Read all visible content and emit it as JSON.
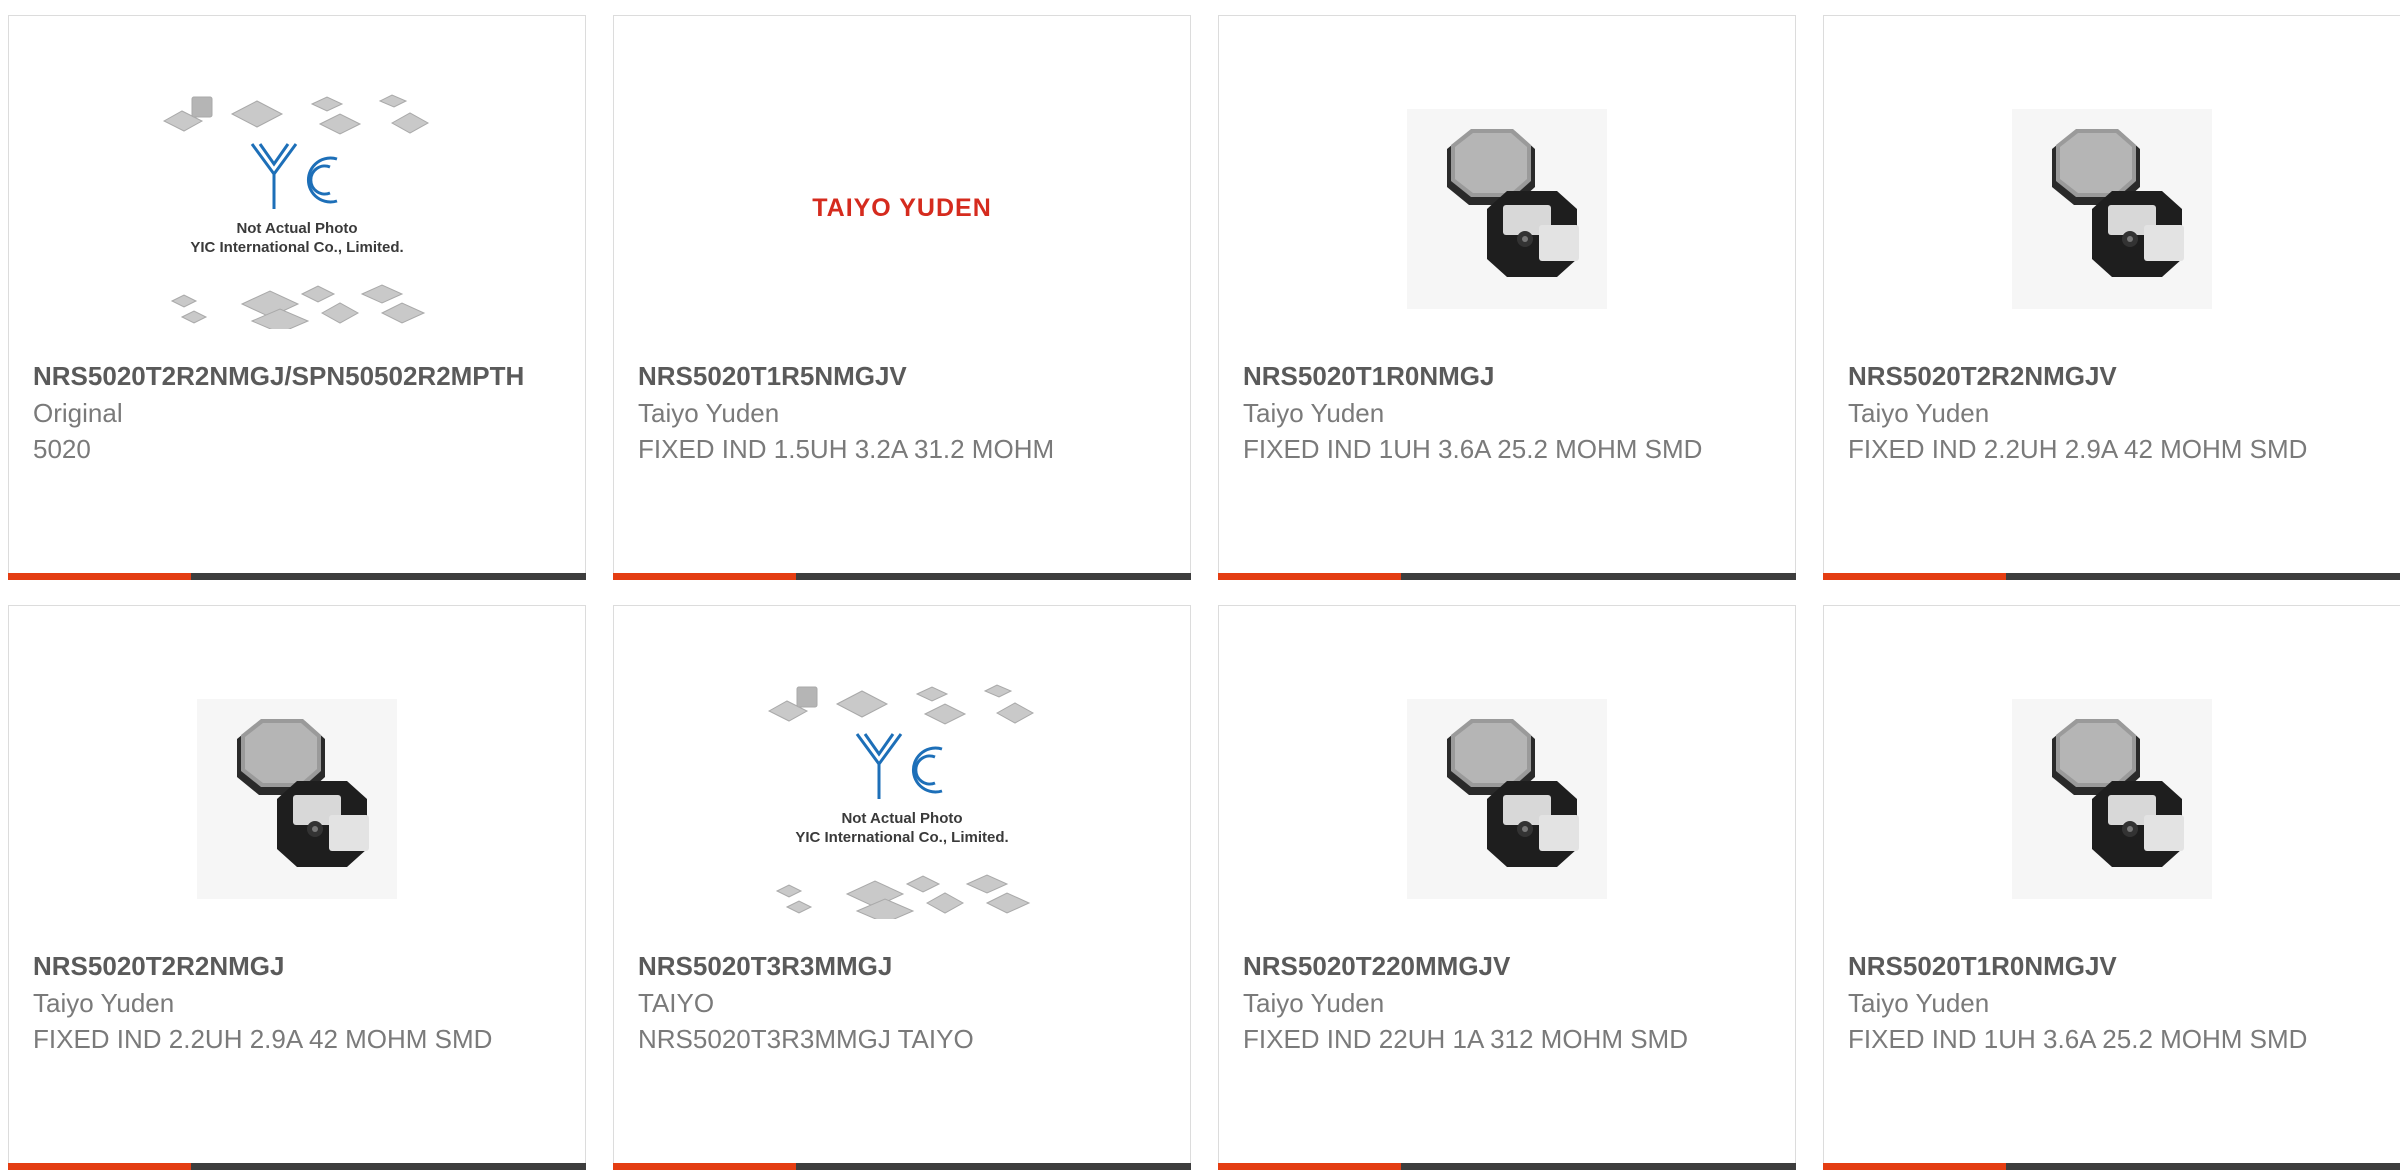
{
  "products": [
    {
      "part_number": "NRS5020T2R2NMGJ/SPN50502R2MPTH",
      "manufacturer": "Original",
      "description": "5020",
      "image": "placeholder"
    },
    {
      "part_number": "NRS5020T1R5NMGJV",
      "manufacturer": "Taiyo Yuden",
      "description": "FIXED IND 1.5UH 3.2A 31.2 MOHM",
      "image": "brand-logo",
      "brand_logo_text": "TAIYO YUDEN"
    },
    {
      "part_number": "NRS5020T1R0NMGJ",
      "manufacturer": "Taiyo Yuden",
      "description": "FIXED IND 1UH 3.6A 25.2 MOHM SMD",
      "image": "inductor"
    },
    {
      "part_number": "NRS5020T2R2NMGJV",
      "manufacturer": "Taiyo Yuden",
      "description": "FIXED IND 2.2UH 2.9A 42 MOHM SMD",
      "image": "inductor"
    },
    {
      "part_number": "NRS5020T2R2NMGJ",
      "manufacturer": "Taiyo Yuden",
      "description": "FIXED IND 2.2UH 2.9A 42 MOHM SMD",
      "image": "inductor"
    },
    {
      "part_number": "NRS5020T3R3MMGJ",
      "manufacturer": "TAIYO",
      "description": "NRS5020T3R3MMGJ TAIYO",
      "image": "placeholder"
    },
    {
      "part_number": "NRS5020T220MMGJV",
      "manufacturer": "Taiyo Yuden",
      "description": "FIXED IND 22UH 1A 312 MOHM SMD",
      "image": "inductor"
    },
    {
      "part_number": "NRS5020T1R0NMGJV",
      "manufacturer": "Taiyo Yuden",
      "description": "FIXED IND 1UH 3.6A 25.2 MOHM SMD",
      "image": "inductor"
    }
  ],
  "placeholder": {
    "logo_text": "YIC",
    "line1": "Not Actual Photo",
    "line2": "YIC International Co., Limited."
  },
  "colors": {
    "accent": "#e43d12",
    "bar": "#3d3d3d",
    "border": "#dcdcdc",
    "brand_red": "#d52b1e",
    "yic_blue": "#1d6fb8"
  }
}
